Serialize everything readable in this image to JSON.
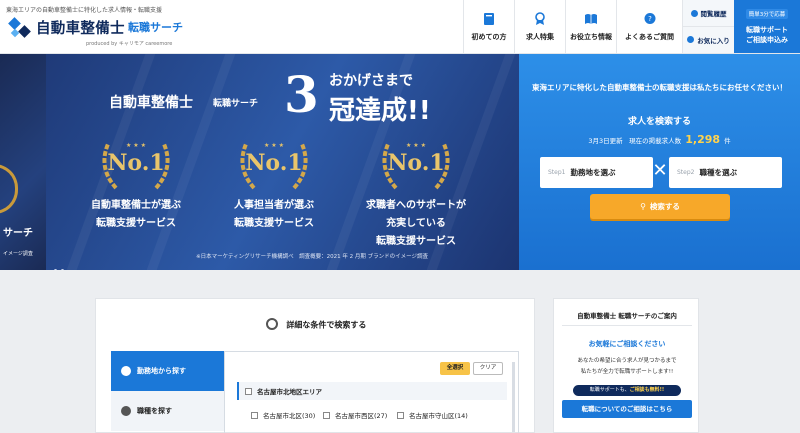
{
  "header": {
    "tagline": "東海エリアの自動車整備士に特化した求人情報・転職支援",
    "logo": {
      "title": "自動車整備士",
      "subtitle": "転職サーチ",
      "byline": "produced by キャリモア careemore"
    },
    "nav": [
      {
        "label": "初めての方",
        "icon": "book-icon"
      },
      {
        "label": "求人特集",
        "icon": "award-ribbon-icon"
      },
      {
        "label": "お役立ち情報",
        "icon": "open-book-icon"
      },
      {
        "label": "よくあるご質問",
        "icon": "question-bubble-icon"
      }
    ],
    "side_buttons": {
      "history": "閲覧履歴",
      "favorites": "お気に入り"
    },
    "cta": {
      "small": "簡単3分で応募",
      "main_line1": "転職サポート",
      "main_line2": "ご相談申込み"
    }
  },
  "hero": {
    "left_partial": {
      "line1": "サーチ",
      "line2": "イメージ調査"
    },
    "banner": {
      "brand": "自動車整備士",
      "brand_sub": "転職サーチ",
      "number": "3",
      "thanks": "おかげさまで",
      "achieved": "冠達成!!",
      "awards": [
        {
          "badge": "No.1",
          "line1": "自動車整備士が選ぶ",
          "line2": "転職支援サービス",
          "line3": ""
        },
        {
          "badge": "No.1",
          "line1": "人事担当者が選ぶ",
          "line2": "転職支援サービス",
          "line3": ""
        },
        {
          "badge": "No.1",
          "line1": "求職者へのサポートが",
          "line2": "充実している",
          "line3": "転職支援サービス"
        }
      ],
      "footnote": "※日本マーケティングリサーチ機構調べ　調査概要：2021 年 2 月期 ブランドのイメージ調査"
    }
  },
  "search": {
    "lead": "東海エリアに特化した自動車整備士の転職支援は私たちにお任せください！",
    "title": "求人を検索する",
    "count_prefix": "3月3日更新　現在の掲載求人数",
    "count": "1,298",
    "count_suffix": "件",
    "step1": {
      "step": "Step1",
      "label": "勤務地を選ぶ"
    },
    "step2": {
      "step": "Step2",
      "label": "職種を選ぶ"
    },
    "x_symbol": "✕",
    "button": "検索する"
  },
  "detail_search": {
    "title": "詳細な条件で検索する",
    "tabs": [
      "勤務地から探す",
      "職種を探す"
    ],
    "select_all": "全選択",
    "clear": "クリア",
    "area": "名古屋市北地区エリア",
    "cities": [
      "名古屋市北区(30)",
      "名古屋市西区(27)",
      "名古屋市守山区(14)"
    ]
  },
  "consult": {
    "title": "自動車整備士 転職サーチのご案内",
    "free": "お気軽にご相談ください",
    "text1": "あなたの希望に合う求人が見つかるまで",
    "text2": "私たちが全力で転職サポートします!!",
    "tag_prefix": "転職サポートも、",
    "tag_emph": "ご相談も無料!!",
    "button": "転職についてのご相談はこちら"
  },
  "colors": {
    "brand_blue": "#1b78d8",
    "navy": "#0f2a5c",
    "accent_orange": "#f7a829",
    "gold": "#e9c56b"
  }
}
